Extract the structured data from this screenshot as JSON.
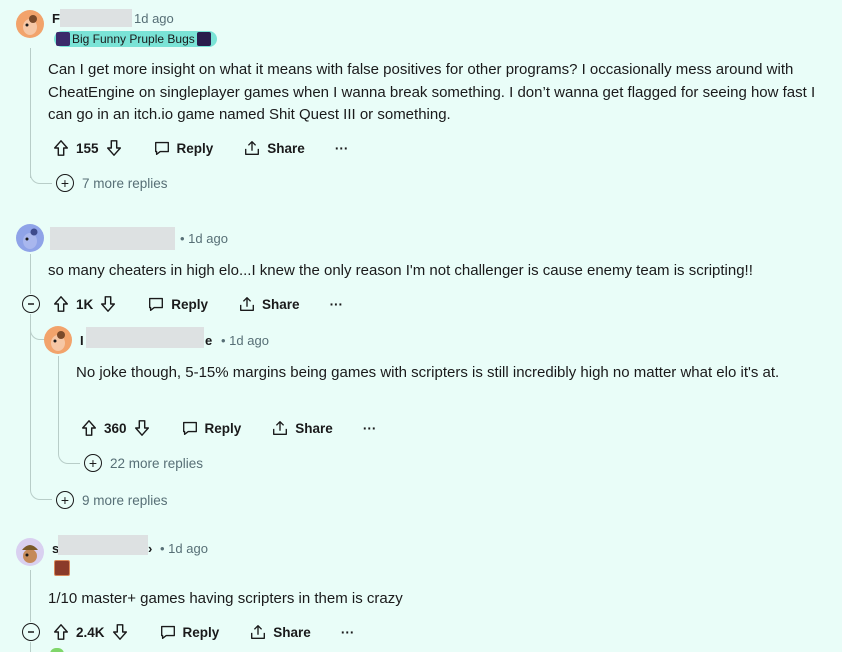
{
  "comments": [
    {
      "username": "F",
      "time": "1d ago",
      "flair": "Big Funny Pruple Bugs",
      "body": "Can I get more insight on what it means with false positives for other programs? I occasionally mess around with CheatEngine on singleplayer games when I wanna break something. I don’t wanna get flagged for seeing how fast I can go in an itch.io game named Shit Quest III or something.",
      "votes": "155",
      "reply": "Reply",
      "share": "Share",
      "more": "···",
      "more_replies": "7 more replies"
    },
    {
      "username": "",
      "time": "• 1d ago",
      "body": "so many cheaters in high elo...I knew the only reason I'm not challenger is cause enemy team is scripting!!",
      "votes": "1K",
      "reply": "Reply",
      "share": "Share",
      "more": "···",
      "more_replies": "9 more replies"
    },
    {
      "username_prefix": "I",
      "username_suffix": "e",
      "time": "• 1d ago",
      "body": "No joke though, 5-15% margins being games with scripters is still incredibly high no matter what elo it's at.",
      "votes": "360",
      "reply": "Reply",
      "share": "Share",
      "more": "···",
      "more_replies": "22 more replies"
    },
    {
      "username_prefix": "s",
      "username_suffix": "›",
      "time": "• 1d ago",
      "body": "1/10 master+ games having scripters in them is crazy",
      "votes": "2.4K",
      "reply": "Reply",
      "share": "Share",
      "more": "···"
    }
  ],
  "colors": {
    "background": "#e9fdf8",
    "flair": "#7ae3d6",
    "avatar_orange": "#f2a36b",
    "avatar_blue": "#8fa3e8"
  }
}
